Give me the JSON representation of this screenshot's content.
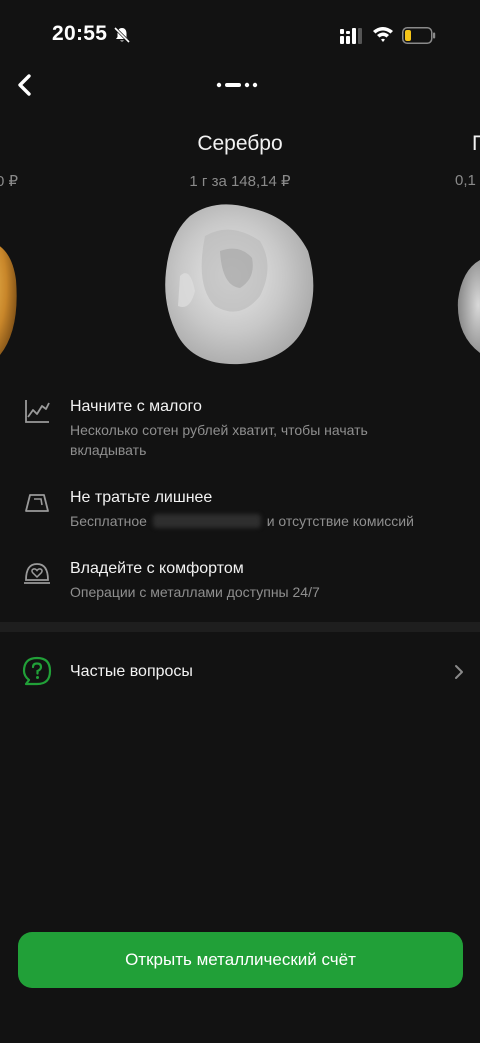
{
  "status_bar": {
    "time": "20:55",
    "icons": [
      "bell-muted-icon",
      "signal-icon",
      "wifi-icon",
      "battery-low-icon"
    ],
    "battery_color": "#f5c518"
  },
  "nav": {
    "back_icon": "chevron-left-icon",
    "pager_icon": "page-dots-icon"
  },
  "carousel": {
    "current": {
      "title": "Серебро",
      "price": "1 г за 148,14 ₽"
    },
    "left_partial": {
      "price": "0 ₽"
    },
    "right_partial": {
      "title": "П",
      "price": "0,1"
    }
  },
  "features": [
    {
      "icon": "chart-line-icon",
      "title": "Начните с малого",
      "desc": "Несколько сотен рублей хватит, чтобы начать вкладывать"
    },
    {
      "icon": "bar-ingot-icon",
      "title": "Не тратьте лишнее",
      "desc_before": "Бесплатное",
      "desc_after": "и отсутствие комиссий"
    },
    {
      "icon": "safe-heart-icon",
      "title": "Владейте с комфортом",
      "desc": "Операции с металлами доступны 24/7"
    }
  ],
  "faq": {
    "label": "Частые вопросы",
    "icon": "question-chat-icon"
  },
  "cta": {
    "label": "Открыть металлический счёт",
    "color": "#21a038"
  },
  "colors": {
    "background": "#121212",
    "accent": "#21a038",
    "secondary_text": "#8f8f8f"
  }
}
